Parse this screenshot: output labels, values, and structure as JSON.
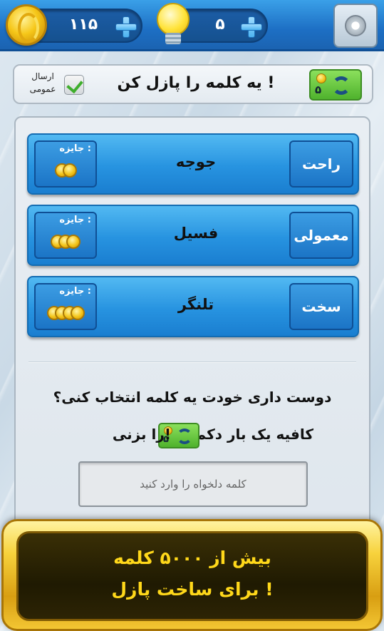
{
  "topbar": {
    "coins": "۱۱۵",
    "hints": "۵"
  },
  "header": {
    "public_label": "ارسال عمومی",
    "title": "یه کلمه را پازل کن !",
    "refresh_cost": "۵"
  },
  "levels": [
    {
      "difficulty": "راحت",
      "word": "جوجه",
      "reward_label": "جایزه :",
      "reward_coins": 2
    },
    {
      "difficulty": "معمولی",
      "word": "فسیل",
      "reward_label": "جایزه :",
      "reward_coins": 3
    },
    {
      "difficulty": "سخت",
      "word": "تلنگر",
      "reward_label": "جایزه :",
      "reward_coins": 4
    }
  ],
  "custom": {
    "question": "دوست داری خودت یه کلمه انتخاب کنی؟",
    "instruction_a": "کافیه یک بار دکمه",
    "instruction_b": "را بزنی!",
    "button_cost": "۵",
    "input_placeholder": "کلمه دلخواه را وارد کنید"
  },
  "promo": {
    "line1": "بیش از ۵۰۰۰ کلمه",
    "line2": "برای ساخت پازل !"
  }
}
